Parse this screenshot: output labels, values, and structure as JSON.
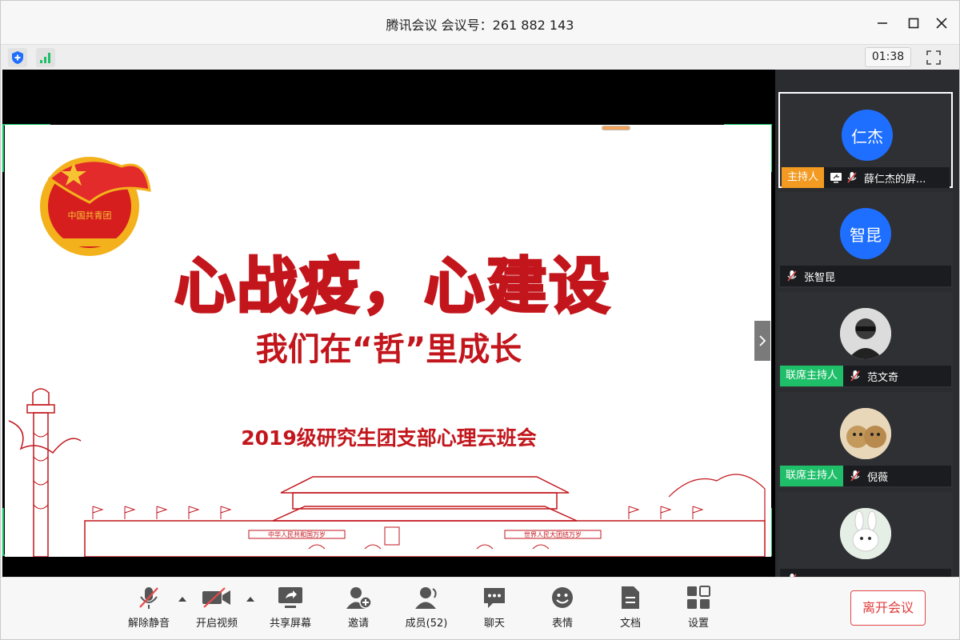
{
  "window": {
    "title": "腾讯会议 会议号：261 882 143"
  },
  "infobar": {
    "timer": "01:38",
    "icons": [
      "shield-icon",
      "signal-icon",
      "fullscreen-icon"
    ]
  },
  "slide": {
    "title": "心战疫，心建设",
    "subtitle": "我们在“哲”里成长",
    "event": "2019级研究生团支部心理云班会",
    "banner_left": "中华人民共和国万岁",
    "banner_right": "世界人民大团结万岁",
    "emblem_text": "中国共青团"
  },
  "participants": [
    {
      "avatar": "仁杰",
      "role": "主持人",
      "name": "薛仁杰的屏...",
      "muted": true,
      "sharing": true,
      "active": true
    },
    {
      "avatar": "智昆",
      "role": "",
      "name": "张智昆",
      "muted": true,
      "sharing": false,
      "active": false
    },
    {
      "avatar": "",
      "role": "联席主持人",
      "name": "范文奇",
      "muted": true,
      "sharing": false,
      "active": false
    },
    {
      "avatar": "",
      "role": "联席主持人",
      "name": "倪薇",
      "muted": true,
      "sharing": false,
      "active": false
    },
    {
      "avatar": "",
      "role": "",
      "name": "",
      "muted": true,
      "sharing": false,
      "active": false
    }
  ],
  "toolbar": {
    "unmute": "解除静音",
    "start_video": "开启视频",
    "share_screen": "共享屏幕",
    "invite": "邀请",
    "members": "成员(52)",
    "chat": "聊天",
    "reactions": "表情",
    "docs": "文档",
    "settings": "设置",
    "leave": "离开会议"
  },
  "colors": {
    "accent_blue": "#1e6fff",
    "host_orange": "#f29a21",
    "cohost_green": "#1fbf6a",
    "slide_red": "#c2161c",
    "leave_red": "#e03a3a",
    "frame_green": "#18c464"
  }
}
